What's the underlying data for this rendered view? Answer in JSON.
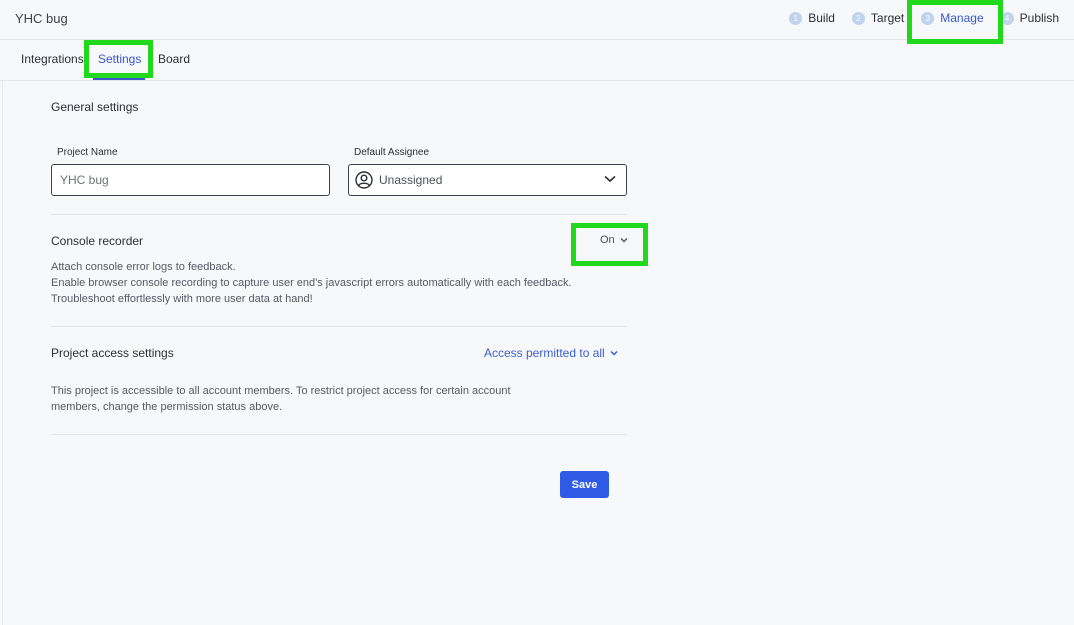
{
  "header": {
    "project_title": "YHC bug",
    "steps": [
      {
        "num": "1",
        "label": "Build"
      },
      {
        "num": "2",
        "label": "Target"
      },
      {
        "num": "3",
        "label": "Manage"
      },
      {
        "num": "4",
        "label": "Publish"
      }
    ],
    "active_step": "Manage"
  },
  "tabs": [
    {
      "label": "Integrations"
    },
    {
      "label": "Settings"
    },
    {
      "label": "Board"
    }
  ],
  "active_tab": "Settings",
  "general": {
    "title": "General settings",
    "project_name_label": "Project Name",
    "project_name_value": "YHC bug",
    "default_assignee_label": "Default Assignee",
    "default_assignee_value": "Unassigned"
  },
  "console": {
    "title": "Console recorder",
    "state": "On",
    "desc_lines": [
      "Attach console error logs to feedback.",
      "Enable browser console recording to capture user end's javascript errors automatically with each feedback.",
      "Troubleshoot effortlessly with more user data at hand!"
    ]
  },
  "access": {
    "title": "Project access settings",
    "value": "Access permitted to all",
    "desc_lines": [
      "This project is accessible to all account members. To restrict project access for certain account",
      "members, change the permission status above."
    ]
  },
  "save_label": "Save",
  "colors": {
    "accent": "#3858c9",
    "button": "#2f5be6",
    "highlight": "#21d81d"
  }
}
